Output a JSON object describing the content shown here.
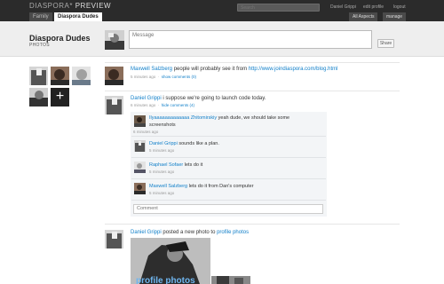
{
  "app": {
    "brand_left": "DIASPORA*",
    "brand_right": "PREVIEW"
  },
  "top_bar": {
    "search_placeholder": "Search",
    "user_name": "Daniel Grippi",
    "edit_profile": "edit profile",
    "logout": "logout",
    "tabs": [
      "Family",
      "Diaspora Dudes"
    ],
    "right_tabs": [
      "All Aspects",
      "manage"
    ]
  },
  "aspect": {
    "title": "Diaspora Dudes",
    "subtitle": "PHOTOS"
  },
  "composer": {
    "placeholder": "Message",
    "share_label": "Share"
  },
  "members": {
    "add_icon": "plus-icon",
    "add_glyph": "+"
  },
  "posts": [
    {
      "author": "Maxwell Salzberg",
      "text": "people will probably see it from",
      "link": "http://www.joindiaspora.com/blog.html",
      "time": "5 minutes ago",
      "action": "show comments (0)"
    },
    {
      "author": "Daniel Grippi",
      "text": "i suppose we're going to launch code today.",
      "time": "6 minutes ago",
      "action": "hide comments (4)",
      "comments": [
        {
          "author": "Ilyaaaaaaaaaaaaa Zhitomirskiy",
          "text": "yeah dude, we should take some",
          "text2": "screenshots",
          "time": "6 minutes ago"
        },
        {
          "author": "Daniel Grippi",
          "text": "sounds like a plan.",
          "time": "5 minutes ago"
        },
        {
          "author": "Raphael Sofaer",
          "text": "lets do it",
          "time": "5 minutes ago"
        },
        {
          "author": "Maxwell Salzberg",
          "text": "lets do it from Dan's computer",
          "time": "5 minutes ago"
        }
      ],
      "comment_placeholder": "Comment"
    },
    {
      "author": "Daniel Grippi",
      "text": "posted a new photo to",
      "album": "profile photos",
      "photo_caption": "profile photos"
    }
  ]
}
